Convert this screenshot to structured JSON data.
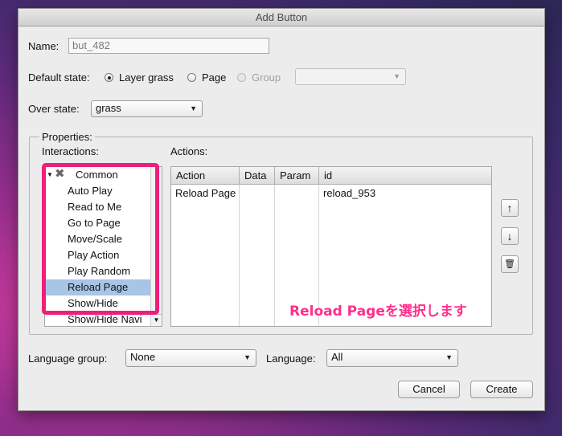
{
  "window": {
    "title": "Add Button"
  },
  "name": {
    "label": "Name:",
    "value": "but_482"
  },
  "default_state": {
    "label": "Default state:",
    "options": [
      {
        "label": "Layer grass",
        "selected": true,
        "enabled": true
      },
      {
        "label": "Page",
        "selected": false,
        "enabled": true
      },
      {
        "label": "Group",
        "selected": false,
        "enabled": false
      }
    ],
    "group_select_value": ""
  },
  "over_state": {
    "label": "Over state:",
    "value": "grass"
  },
  "properties": {
    "label": "Properties:",
    "interactions_label": "Interactions:",
    "actions_label": "Actions:",
    "interactions": {
      "category": "Common",
      "items": [
        "Auto Play",
        "Read to Me",
        "Go to Page",
        "Move/Scale",
        "Play Action",
        "Play Random",
        "Reload Page",
        "Show/Hide",
        "Show/Hide Navi"
      ],
      "selected": "Reload Page"
    },
    "actions_table": {
      "columns": [
        "Action",
        "Data",
        "Param",
        "id"
      ],
      "rows": [
        {
          "action": "Reload Page",
          "data": "",
          "param": "",
          "id": "reload_953"
        }
      ]
    }
  },
  "side_buttons": {
    "up": "↑",
    "down": "↓",
    "delete": "🗑"
  },
  "language_group": {
    "label": "Language group:",
    "value": "None"
  },
  "language": {
    "label": "Language:",
    "value": "All"
  },
  "buttons": {
    "cancel": "Cancel",
    "create": "Create"
  },
  "annotation": {
    "text": "Reload Pageを選択します",
    "color": "#ff2f8a"
  },
  "colors": {
    "highlight": "#ee1f7a",
    "selection": "#a8c4e6"
  }
}
